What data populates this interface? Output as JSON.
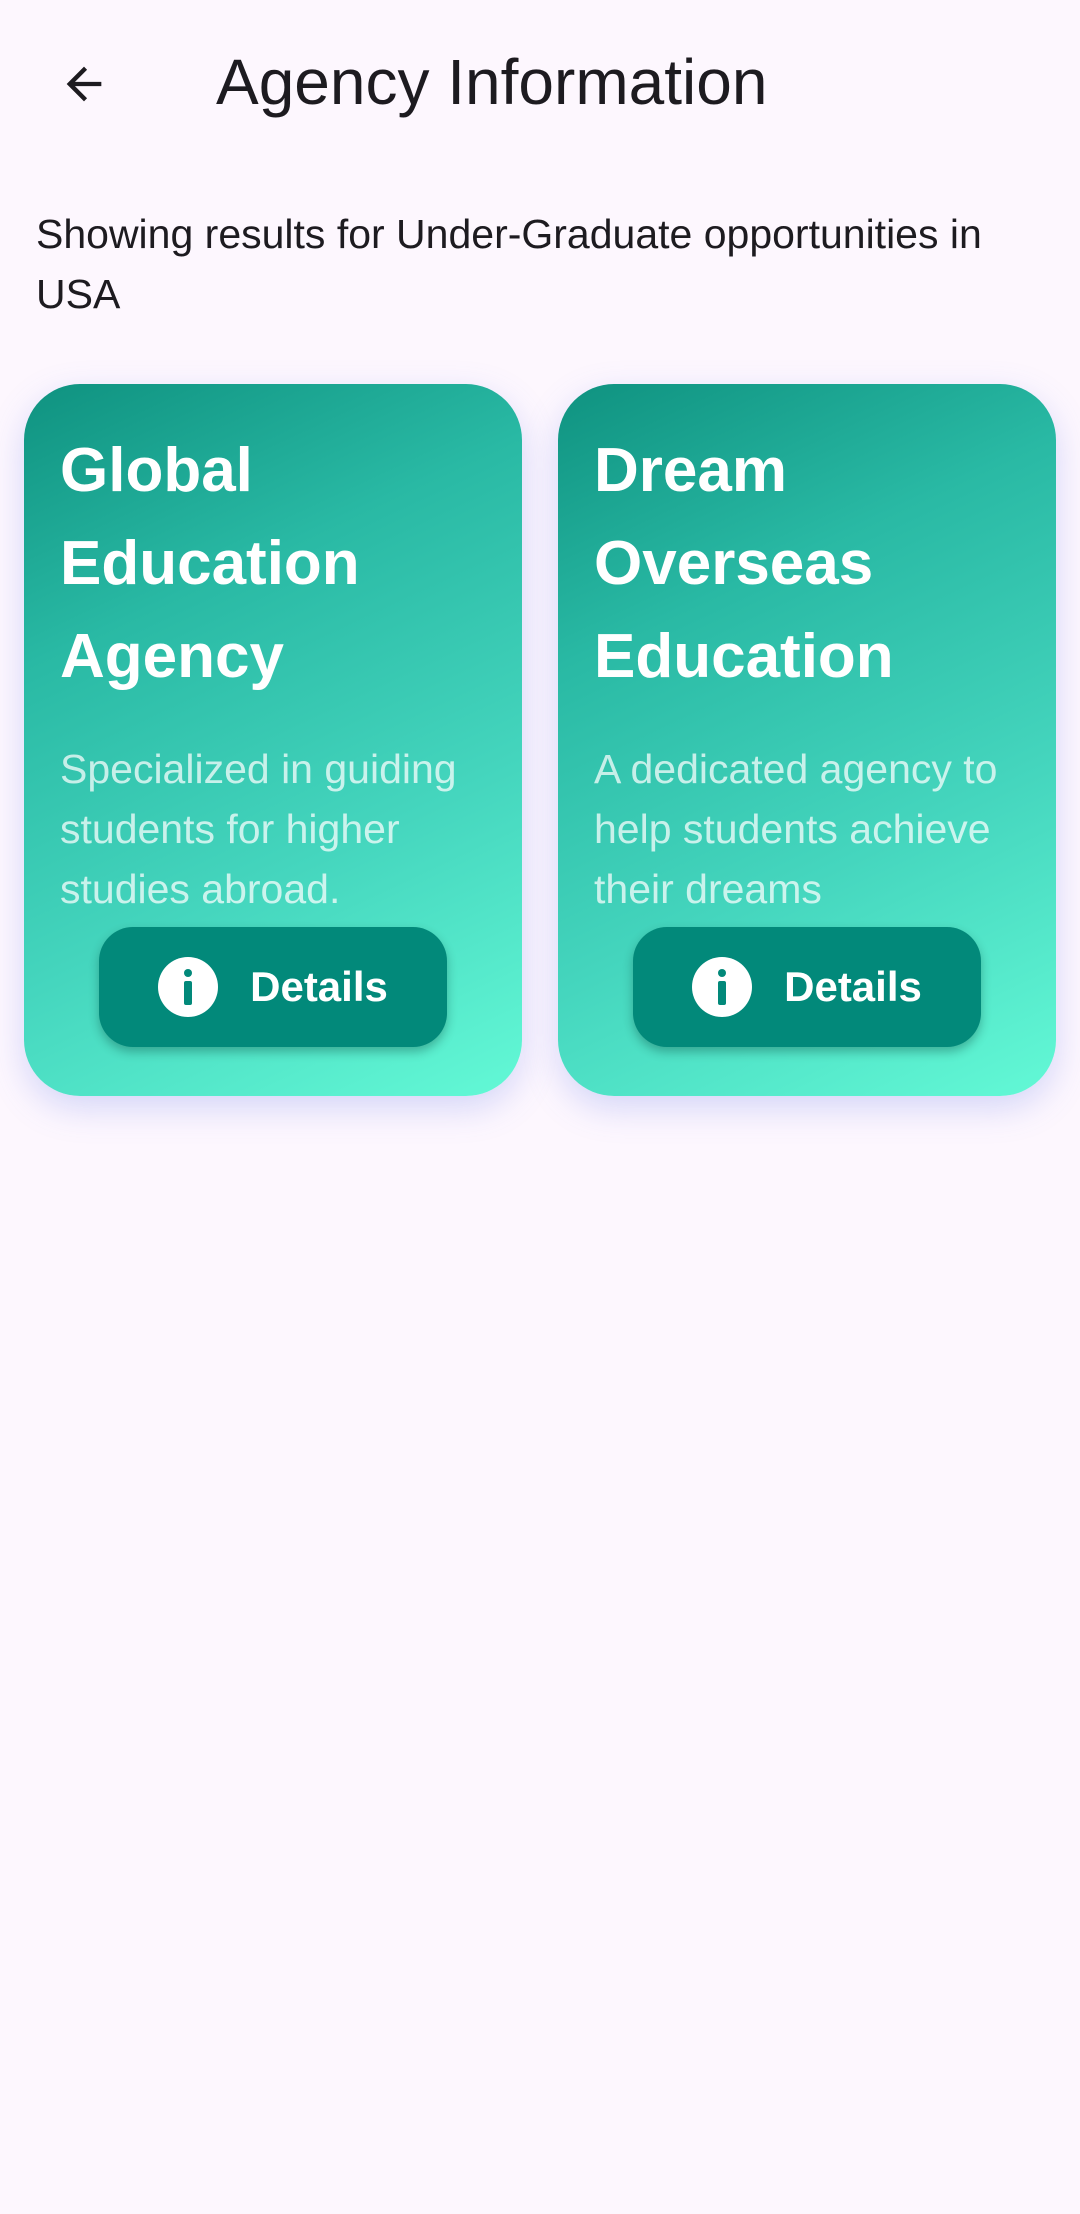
{
  "header": {
    "title": "Agency Information",
    "back_icon": "arrow-back-icon"
  },
  "results": {
    "text": "Showing results for Under-Graduate opportunities in USA"
  },
  "colors": {
    "background": "#fdf7fe",
    "card_gradient_start": "#0f9280",
    "card_gradient_end": "#63f9d6",
    "button": "#02897a"
  },
  "agencies": [
    {
      "name": "Global Education Agency",
      "description": "Specialized in guiding students for higher studies abroad.",
      "button_label": "Details",
      "button_icon": "info-icon"
    },
    {
      "name": "Dream Overseas Education",
      "description": "A dedicated agency to help students achieve their dreams",
      "button_label": "Details",
      "button_icon": "info-icon"
    }
  ]
}
